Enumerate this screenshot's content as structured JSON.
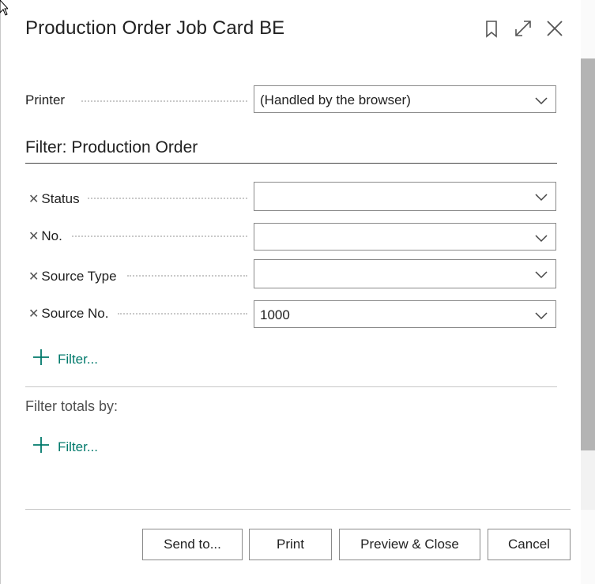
{
  "dialog": {
    "title": "Production Order Job Card BE",
    "icons": {
      "bookmark": "bookmark-icon",
      "expand": "expand-icon",
      "close": "close-icon"
    }
  },
  "printer": {
    "label": "Printer",
    "value": "(Handled by the browser)"
  },
  "filter_section": {
    "title": "Filter: Production Order",
    "fields": [
      {
        "label": "Status",
        "value": ""
      },
      {
        "label": "No.",
        "value": ""
      },
      {
        "label": "Source Type",
        "value": ""
      },
      {
        "label": "Source No.",
        "value": "1000"
      }
    ],
    "add_filter_label": "Filter..."
  },
  "totals_section": {
    "label": "Filter totals by:",
    "add_filter_label": "Filter..."
  },
  "buttons": {
    "send_to": "Send to...",
    "print": "Print",
    "preview_close": "Preview & Close",
    "cancel": "Cancel"
  },
  "colors": {
    "accent": "#00796b",
    "border": "#8a8a8a",
    "text": "#212121"
  }
}
